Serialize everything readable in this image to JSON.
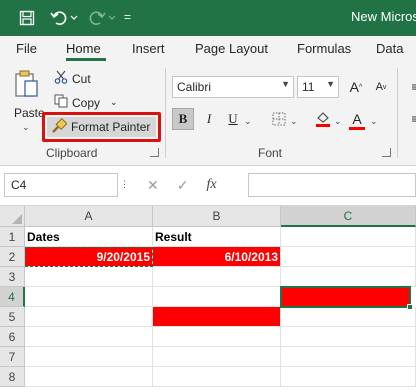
{
  "titlebar": {
    "title": "New Microso",
    "qat_separator": "="
  },
  "tabs": [
    {
      "label": "File"
    },
    {
      "label": "Home"
    },
    {
      "label": "Insert"
    },
    {
      "label": "Page Layout"
    },
    {
      "label": "Formulas"
    },
    {
      "label": "Data"
    }
  ],
  "ribbon": {
    "clipboard": {
      "paste_label": "Paste",
      "cut_label": "Cut",
      "copy_label": "Copy",
      "format_painter_label": "Format Painter",
      "group_label": "Clipboard"
    },
    "font": {
      "font_name": "Calibri",
      "font_size": "11",
      "group_label": "Font",
      "fill_color": "#ffff00",
      "font_color": "#ff0000"
    }
  },
  "formula_bar": {
    "name_box": "C4",
    "fx_label": "fx",
    "formula": ""
  },
  "sheet": {
    "columns": [
      "A",
      "B",
      "C"
    ],
    "rows": [
      "1",
      "2",
      "3",
      "4",
      "5",
      "6",
      "7",
      "8"
    ],
    "selected_column": "C",
    "selected_row": "4",
    "cells": {
      "A1": "Dates",
      "B1": "Result",
      "A2": "9/20/2015",
      "B2": "6/10/2013"
    },
    "highlight_color": "#ff0000",
    "accent_color": "#217346"
  }
}
